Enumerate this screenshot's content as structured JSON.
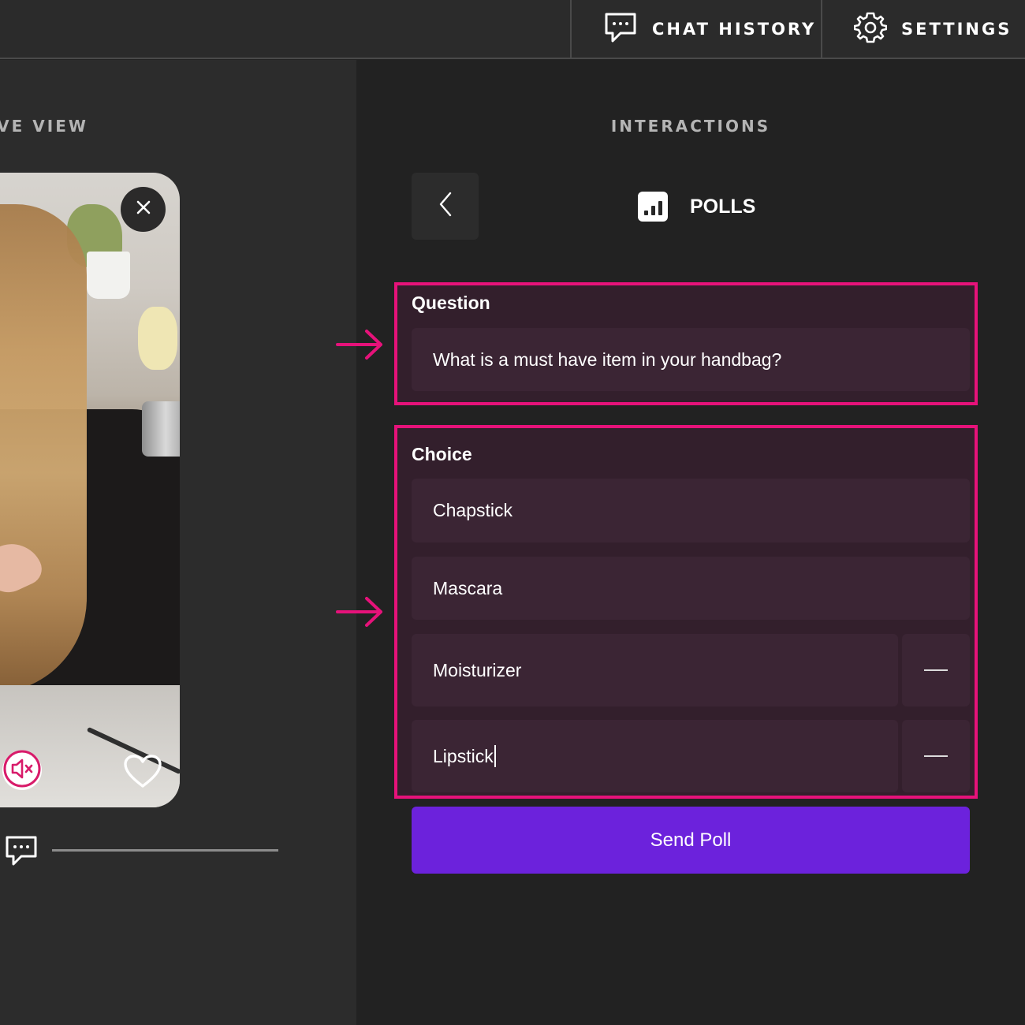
{
  "header": {
    "chat_history_label": "CHAT HISTORY",
    "settings_label": "SETTINGS"
  },
  "left": {
    "title": "LIVE VIEW",
    "chat_progress": 1.0
  },
  "right": {
    "title": "INTERACTIONS",
    "section_label": "POLLS"
  },
  "question": {
    "label": "Question",
    "value": "What is a must have item in your handbag?"
  },
  "choices": {
    "label": "Choice",
    "items": [
      {
        "value": "Chapstick"
      },
      {
        "value": "Mascara"
      },
      {
        "value": "Moisturizer"
      },
      {
        "value": "Lipstick"
      }
    ]
  },
  "actions": {
    "send_label": "Send Poll"
  },
  "colors": {
    "highlight": "#e6127a",
    "send_button": "#6c22dc",
    "mute_icon": "#d81b6a"
  }
}
